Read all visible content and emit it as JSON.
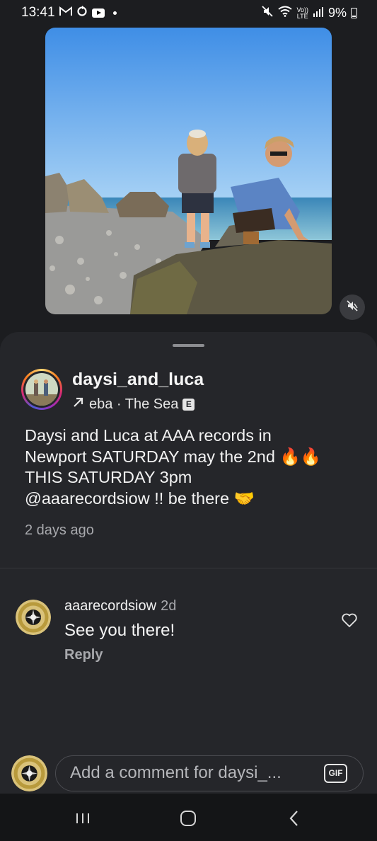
{
  "status": {
    "time": "13:41",
    "battery": "9%",
    "lte_top": "Vo))",
    "lte_bottom": "LTE"
  },
  "post": {
    "username": "daysi_and_luca",
    "music_text": "eba · The Sea",
    "explicit_badge": "E",
    "caption_lines": [
      "Daysi and Luca at AAA records in",
      "Newport SATURDAY may the 2nd 🔥🔥",
      "THIS SATURDAY 3pm",
      "@aaarecordsiow !! be there 🤝"
    ],
    "time_ago": "2 days ago"
  },
  "comment": {
    "username": "aaarecordsiow",
    "time_ago": "2d",
    "text": "See you there!",
    "reply_label": "Reply"
  },
  "composer": {
    "placeholder": "Add a comment for daysi_...",
    "gif_label": "GIF"
  },
  "colors": {
    "background": "#1c1d20",
    "sheet": "#25262a",
    "muted_text": "#a8a9ad"
  },
  "icons": [
    "gmail-icon",
    "sync-icon",
    "youtube-icon",
    "mute-icon",
    "wifi-icon",
    "signal-icon",
    "battery-icon",
    "sound-off-icon",
    "music-arrow-icon",
    "heart-icon",
    "recents-icon",
    "home-icon",
    "back-icon"
  ]
}
